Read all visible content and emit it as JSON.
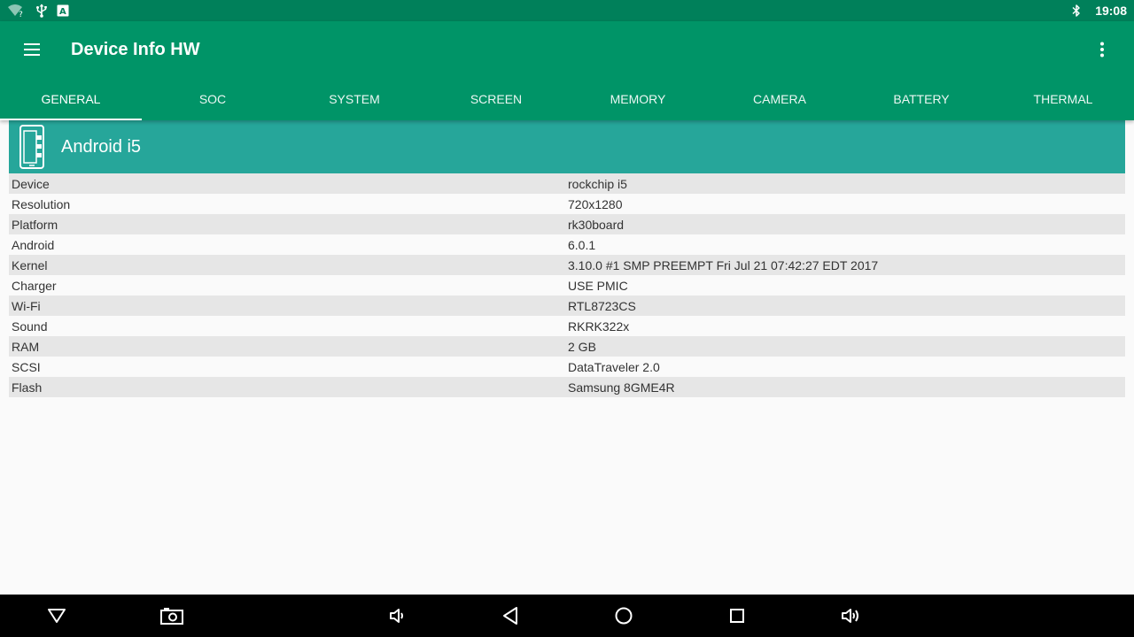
{
  "status_bar": {
    "time": "19:08",
    "icons": [
      "wifi-question-icon",
      "usb-icon",
      "keyboard-a-icon",
      "bluetooth-icon"
    ]
  },
  "app_bar": {
    "title": "Device Info HW",
    "menu_icon": "hamburger-menu-icon",
    "overflow_icon": "more-vert-icon"
  },
  "tabs": [
    {
      "label": "GENERAL",
      "active": true
    },
    {
      "label": "SOC"
    },
    {
      "label": "SYSTEM"
    },
    {
      "label": "SCREEN"
    },
    {
      "label": "MEMORY"
    },
    {
      "label": "CAMERA"
    },
    {
      "label": "BATTERY"
    },
    {
      "label": "THERMAL"
    }
  ],
  "device": {
    "name": "Android i5",
    "icon": "phone-device-icon"
  },
  "info_rows": [
    {
      "label": "Device",
      "value": "rockchip i5"
    },
    {
      "label": "Resolution",
      "value": "720x1280"
    },
    {
      "label": "Platform",
      "value": "rk30board"
    },
    {
      "label": "Android",
      "value": "6.0.1"
    },
    {
      "label": "Kernel",
      "value": "3.10.0 #1 SMP PREEMPT Fri Jul 21 07:42:27 EDT 2017"
    },
    {
      "label": "Charger",
      "value": "USE PMIC"
    },
    {
      "label": "Wi-Fi",
      "value": "RTL8723CS"
    },
    {
      "label": "Sound",
      "value": "RKRK322x"
    },
    {
      "label": "RAM",
      "value": "2 GB"
    },
    {
      "label": "SCSI",
      "value": "DataTraveler 2.0"
    },
    {
      "label": "Flash",
      "value": "Samsung 8GME4R"
    }
  ],
  "nav_bar": {
    "buttons": [
      "hide-nav-icon",
      "screenshot-icon",
      "volume-down-icon",
      "back-icon",
      "home-icon",
      "recents-icon",
      "volume-up-icon"
    ]
  },
  "colors": {
    "status_bar": "#00805a",
    "app_bar": "#009467",
    "device_header": "#26a69a",
    "row_stripe": "#e6e6e6",
    "background": "#fafafa"
  }
}
